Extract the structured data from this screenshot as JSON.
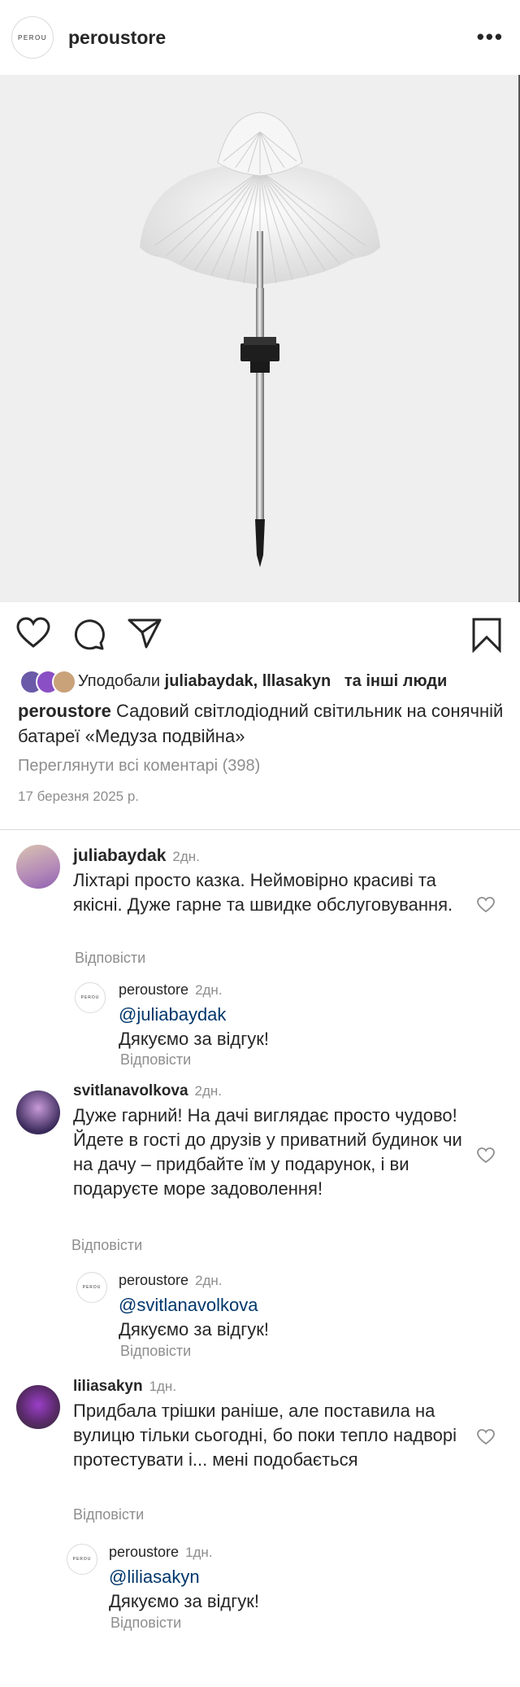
{
  "header": {
    "username": "peroustore",
    "logo_text": "PEROU",
    "more_glyph": "•••"
  },
  "photo": {
    "alt_subject": "solar-jellyfish-lamp"
  },
  "icons": {
    "like": "heart-icon",
    "comment": "comment-icon",
    "share": "send-icon",
    "save": "bookmark-icon"
  },
  "likes": {
    "prefix": "Уподобали",
    "users": "juliabaydak, lllasakyn",
    "suffix": "та інші люди"
  },
  "caption": {
    "username": "peroustore",
    "text": "Садовий світлодіодний світильник на сонячній батареї «Медуза подвійна»"
  },
  "view_all_comments": "Переглянути всі коментарі (398)",
  "date": "17 березня 2025 р.",
  "comments": [
    {
      "username": "juliabaydak",
      "time": "2дн.",
      "text": "Ліхтарі просто казка. Неймовірно красиві та якісні. Дуже гарне та швидке обслуговування.",
      "reply_label": "Відповісти",
      "reply": {
        "username": "peroustore",
        "time": "2дн.",
        "mention": "@juliabaydak",
        "text": "Дякуємо за відгук!",
        "reply_label": "Відповісти"
      }
    },
    {
      "username": "svitlanavolkova",
      "time": "2дн.",
      "text": "Дуже гарний! На дачі виглядає просто чудово! Йдете в гості до друзів у приватний будинок чи на дачу – придбайте їм у подарунок, і ви подаруєте море задоволення!",
      "reply_label": "Відповісти",
      "reply": {
        "username": "peroustore",
        "time": "2дн.",
        "mention": "@svitlanavolkova",
        "text": "Дякуємо за відгук!",
        "reply_label": "Відповісти"
      }
    },
    {
      "username": "liliasakyn",
      "time": "1дн.",
      "text": "Придбала трішки раніше, але поставила на вулицю тільки сьогодні, бо поки тепло надворі протестувати і... мені подобається",
      "reply_label": "Відповісти",
      "reply": {
        "username": "peroustore",
        "time": "1дн.",
        "mention": "@liliasakyn",
        "text": "Дякуємо за відгук!",
        "reply_label": "Відповісти"
      }
    }
  ],
  "colors": {
    "text": "#262626",
    "muted": "#8e8e8e",
    "mention": "#00376b",
    "photo_bg": "#efefef"
  }
}
